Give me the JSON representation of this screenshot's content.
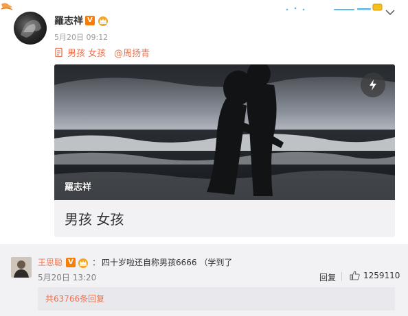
{
  "post": {
    "author": "羅志祥",
    "timestamp": "5月20日 09:12",
    "topic": "男孩 女孩",
    "mention": "@周扬青",
    "card": {
      "watermark": "羅志祥",
      "title": "男孩 女孩"
    }
  },
  "badges": {
    "verified": "V"
  },
  "comment": {
    "author": "王思聪",
    "colon": "：",
    "text": "四十岁啦还自称男孩6666 （学到了",
    "timestamp": "5月20日 13:20",
    "reply_label": "回复",
    "like_count": "1259110",
    "replies_summary": "共63766条回复"
  },
  "colors": {
    "accent": "#eb7350",
    "verified_badge": "#f57e0b",
    "comment_bg": "#f2f2f5"
  },
  "icons": [
    "chevron-down-icon",
    "topic-icon",
    "flash-icon",
    "crown-icon",
    "like-icon"
  ]
}
